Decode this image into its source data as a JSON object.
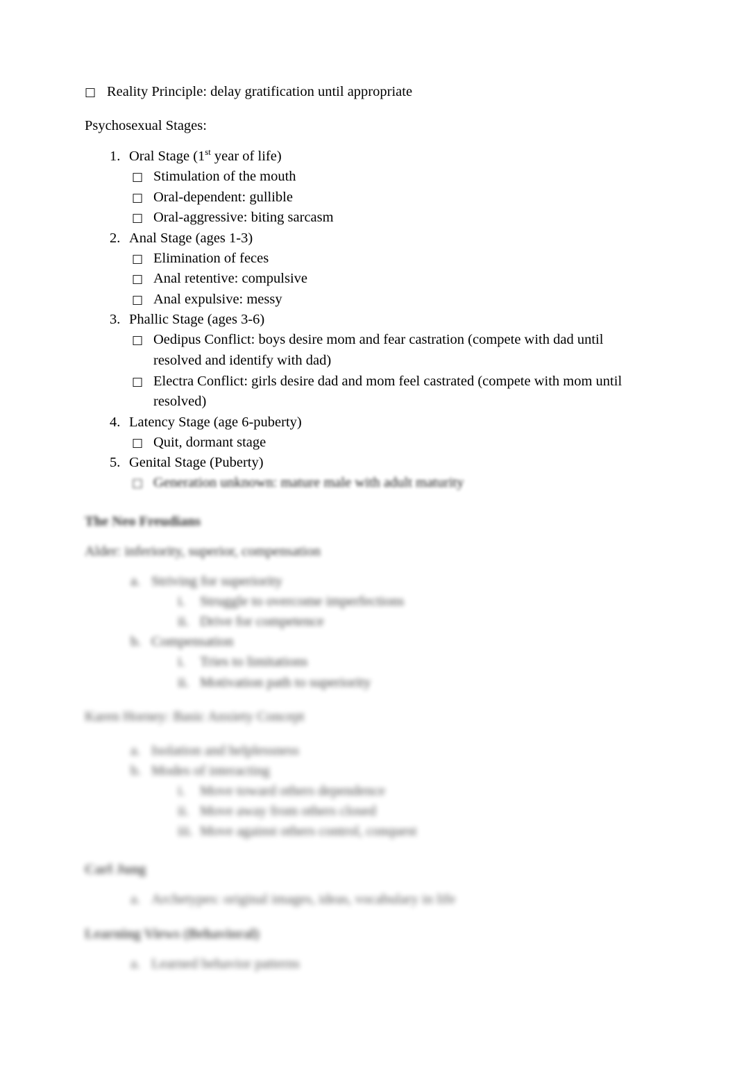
{
  "document": {
    "bullet_glyph": "□",
    "text_color": "#000000",
    "page_color": "#ffffff"
  },
  "intro": {
    "reality_principle": "Reality Principle: delay gratification until appropriate",
    "psychosexual_heading": "Psychosexual Stages:"
  },
  "psychosexual_stages": [
    {
      "number": "1.",
      "title_before_sup": "Oral Stage (1",
      "sup": "st",
      "title_after_sup": " year of life)",
      "subpoints": [
        "Stimulation of the mouth",
        "Oral-dependent: gullible",
        "Oral-aggressive: biting sarcasm"
      ]
    },
    {
      "number": "2.",
      "title": "Anal Stage (ages 1-3)",
      "subpoints": [
        "Elimination of feces",
        "Anal retentive: compulsive",
        "Anal expulsive: messy"
      ]
    },
    {
      "number": "3.",
      "title": "Phallic Stage (ages 3-6)",
      "subpoints": [
        "Oedipus Conflict: boys desire mom and fear castration (compete with dad until resolved and identify with dad)",
        "Electra Conflict: girls desire dad and mom feel castrated (compete with mom until resolved)"
      ]
    },
    {
      "number": "4.",
      "title": "Latency Stage (age 6-puberty)",
      "subpoints": [
        "Quit, dormant stage"
      ]
    },
    {
      "number": "5.",
      "title": "Genital Stage (Puberty)",
      "subpoints": [
        "Generation unknown: mature male with adult maturity"
      ]
    }
  ],
  "adler_section": {
    "heading": "The Neo Freudians",
    "intro": "Alder: inferiority, superior, compensation",
    "items": [
      {
        "marker": "a.",
        "text": "Striving for superiority",
        "subitems": [
          {
            "marker": "i.",
            "text": "Struggle to overcome imperfections"
          },
          {
            "marker": "ii.",
            "text": "Drive for competence"
          }
        ]
      },
      {
        "marker": "b.",
        "text": "Compensation",
        "subitems": [
          {
            "marker": "i.",
            "text": "Tries to limitations"
          },
          {
            "marker": "ii.",
            "text": "Motivation path to superiority"
          }
        ]
      }
    ]
  },
  "horney_section": {
    "heading": "Karen Horney: Basic Anxiety Concept",
    "items": [
      {
        "marker": "a.",
        "text": "Isolation and helplessness"
      },
      {
        "marker": "b.",
        "text": "Modes of interacting"
      }
    ],
    "subitems": [
      {
        "marker": "i.",
        "text": "Move toward others dependence"
      },
      {
        "marker": "ii.",
        "text": "Move away from others closed"
      },
      {
        "marker": "iii.",
        "text": "Move against others control, conquest"
      }
    ]
  },
  "jung_section": {
    "heading": "Carl Jung",
    "items": [
      {
        "marker": "a.",
        "text": "Archetypes: original images, ideas, vocabulary in life"
      }
    ]
  },
  "learning_section": {
    "heading": "Learning Views (Behavioral)",
    "items": [
      {
        "marker": "a.",
        "text": "Learned behavior patterns"
      }
    ]
  }
}
